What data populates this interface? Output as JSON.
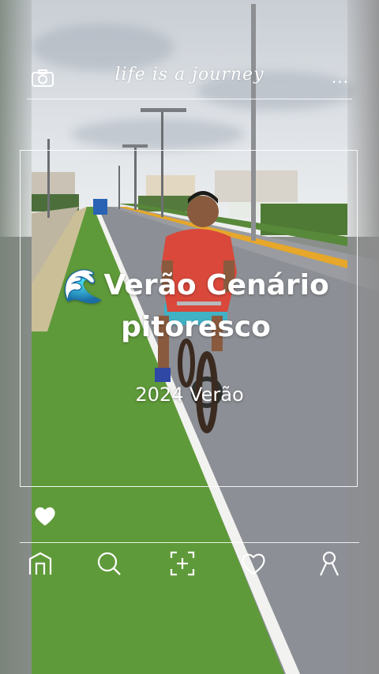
{
  "header": {
    "brand_text": "life is a journey",
    "left_icon": "camera-icon",
    "right_icon": "more-dots-icon",
    "more_text": "..."
  },
  "post": {
    "emoji": "🌊",
    "title_line1": "Verão Cenário",
    "title_line2": "pitoresco",
    "subtitle": "2024 Verão"
  },
  "actions": {
    "like_icon": "heart-icon"
  },
  "bottom_nav": [
    {
      "icon": "home-icon"
    },
    {
      "icon": "search-icon"
    },
    {
      "icon": "add-icon"
    },
    {
      "icon": "heart-outline-icon"
    },
    {
      "icon": "profile-icon"
    }
  ],
  "colors": {
    "overlay_text": "#ffffff",
    "grass": "#5f9a3a",
    "road": "#8a8d93",
    "shirt": "#d9483b"
  }
}
